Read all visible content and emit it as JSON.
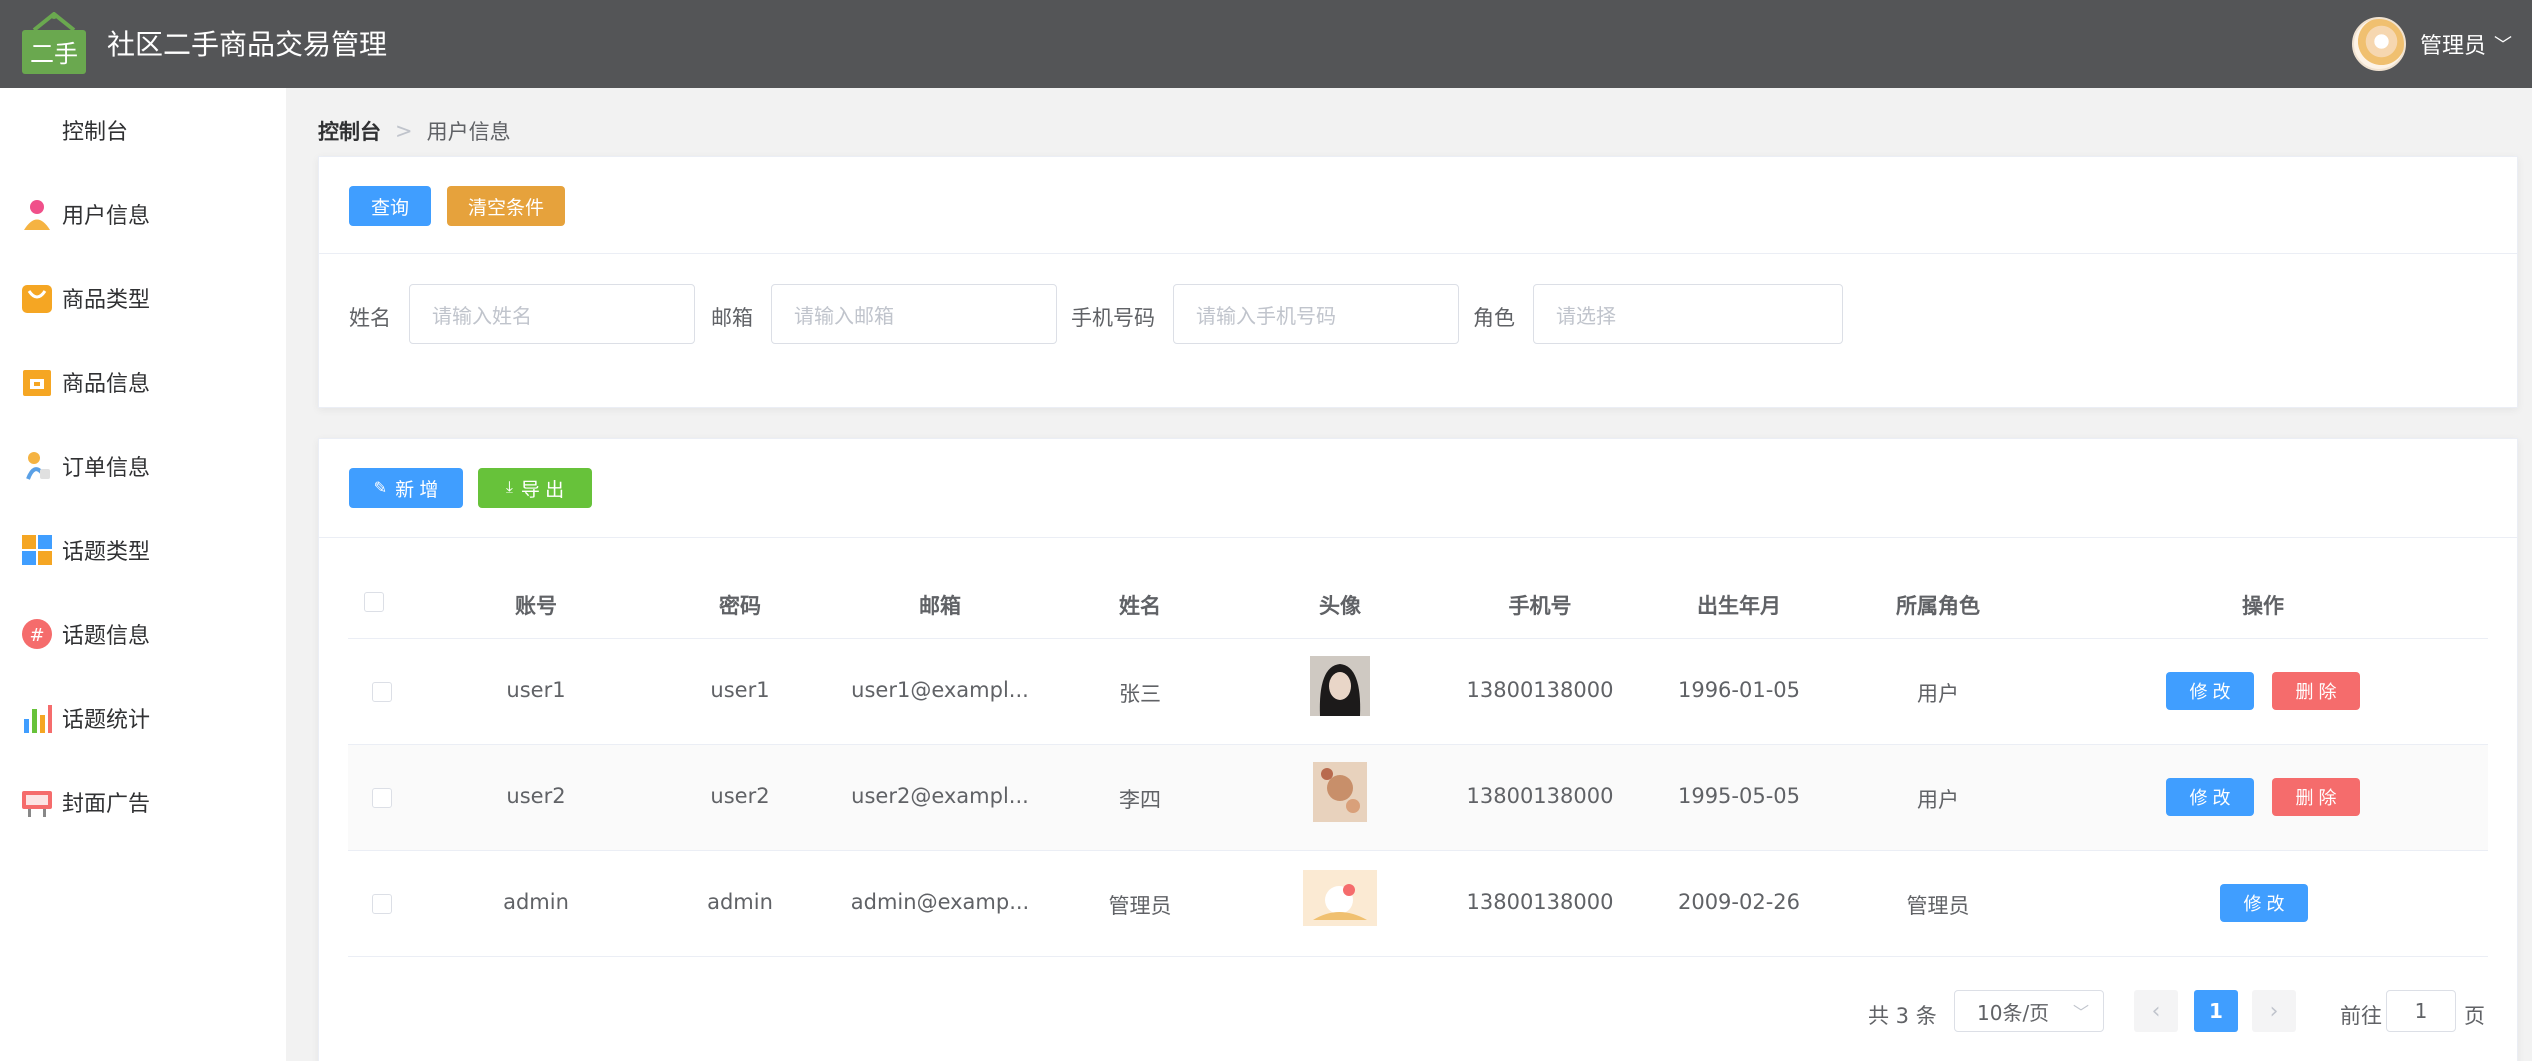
{
  "header": {
    "logo_text": "二手",
    "title": "社区二手商品交易管理",
    "user_name": "管理员",
    "colors": {
      "bar": "#545557",
      "logo": "#6aa84f"
    }
  },
  "sidebar": {
    "items": [
      {
        "label": "控制台",
        "icon": "none"
      },
      {
        "label": "用户信息",
        "icon": "user-icon"
      },
      {
        "label": "商品类型",
        "icon": "shopping-bag-icon"
      },
      {
        "label": "商品信息",
        "icon": "shop-icon"
      },
      {
        "label": "订单信息",
        "icon": "order-icon"
      },
      {
        "label": "话题类型",
        "icon": "grid-icon"
      },
      {
        "label": "话题信息",
        "icon": "hashtag-icon"
      },
      {
        "label": "话题统计",
        "icon": "bar-chart-icon"
      },
      {
        "label": "封面广告",
        "icon": "billboard-icon"
      }
    ]
  },
  "breadcrumb": {
    "root": "控制台",
    "current": "用户信息"
  },
  "search": {
    "query_label": "查询",
    "clear_label": "清空条件",
    "fields": [
      {
        "label": "姓名",
        "placeholder": "请输入姓名"
      },
      {
        "label": "邮箱",
        "placeholder": "请输入邮箱"
      },
      {
        "label": "手机号码",
        "placeholder": "请输入手机号码"
      },
      {
        "label": "角色",
        "placeholder": "请选择"
      }
    ]
  },
  "toolbar": {
    "add_label": "新 增",
    "export_label": "导 出"
  },
  "table": {
    "columns": [
      "账号",
      "密码",
      "邮箱",
      "姓名",
      "头像",
      "手机号",
      "出生年月",
      "所属角色",
      "操作"
    ],
    "rows": [
      {
        "account": "user1",
        "password": "user1",
        "email": "user1@exampl...",
        "name": "张三",
        "phone": "13800138000",
        "birth": "1996-01-05",
        "role": "用户",
        "edit": "修 改",
        "delete": "删 除"
      },
      {
        "account": "user2",
        "password": "user2",
        "email": "user2@exampl...",
        "name": "李四",
        "phone": "13800138000",
        "birth": "1995-05-05",
        "role": "用户",
        "edit": "修 改",
        "delete": "删 除"
      },
      {
        "account": "admin",
        "password": "admin",
        "email": "admin@examp...",
        "name": "管理员",
        "phone": "13800138000",
        "birth": "2009-02-26",
        "role": "管理员",
        "edit": "修 改"
      }
    ]
  },
  "pagination": {
    "total": "共 3 条",
    "page_size": "10条/页",
    "current_page": "1",
    "goto_label": "前往",
    "goto_value": "1",
    "page_suffix": "页"
  },
  "colors": {
    "primary": "#409eff",
    "warning": "#e6a23c",
    "success": "#67c23a",
    "danger": "#f56c6c"
  }
}
